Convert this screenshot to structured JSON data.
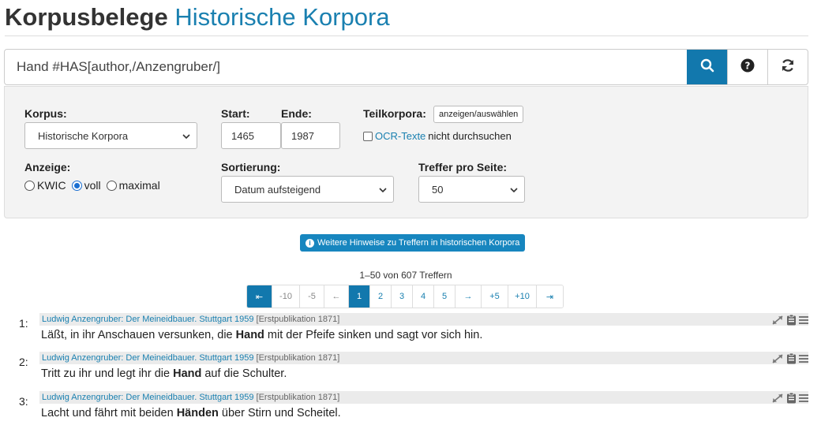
{
  "header": {
    "title": "Korpusbelege",
    "subtitle": "Historische Korpora"
  },
  "search": {
    "query": "Hand #HAS[author,/Anzengruber/]",
    "search_icon": "search-icon",
    "help_icon": "question-circle-icon",
    "reset_icon": "refresh-icon"
  },
  "form": {
    "korpus_label": "Korpus:",
    "korpus_value": "Historische Korpora",
    "start_label": "Start:",
    "start_value": "1465",
    "ende_label": "Ende:",
    "ende_value": "1987",
    "teilkorpora_label": "Teilkorpora:",
    "teilkorpora_button": "anzeigen/auswählen",
    "ocr_link": "OCR-Texte",
    "ocr_rest": "nicht durchsuchen",
    "anzeige_label": "Anzeige:",
    "anzeige_options": [
      "KWIC",
      "voll",
      "maximal"
    ],
    "anzeige_selected": "voll",
    "sortierung_label": "Sortierung:",
    "sortierung_value": "Datum aufsteigend",
    "treffer_label": "Treffer pro Seite:",
    "treffer_value": "50"
  },
  "hint_button": "Weitere Hinweise zu Treffern in historischen Korpora",
  "results_count": "1–50 von 607 Treffern",
  "pagination": [
    "⇤",
    "-10",
    "-5",
    "←",
    "1",
    "2",
    "3",
    "4",
    "5",
    "→",
    "+5",
    "+10",
    "⇥"
  ],
  "pagination_active": "1",
  "hits": [
    {
      "num": "1:",
      "source": "Ludwig Anzengruber: Der Meineidbauer. Stuttgart 1959",
      "pub": "[Erstpublikation 1871]",
      "before": "Läßt, in ihr Anschauen versunken, die ",
      "keyword": "Hand",
      "after": " mit der Pfeife sinken und sagt vor sich hin."
    },
    {
      "num": "2:",
      "source": "Ludwig Anzengruber: Der Meineidbauer. Stuttgart 1959",
      "pub": "[Erstpublikation 1871]",
      "before": "Tritt zu ihr und legt ihr die ",
      "keyword": "Hand",
      "after": " auf die Schulter."
    },
    {
      "num": "3:",
      "source": "Ludwig Anzengruber: Der Meineidbauer. Stuttgart 1959",
      "pub": "[Erstpublikation 1871]",
      "before": "Lacht und fährt mit beiden ",
      "keyword": "Händen",
      "after": " über Stirn und Scheitel."
    }
  ]
}
